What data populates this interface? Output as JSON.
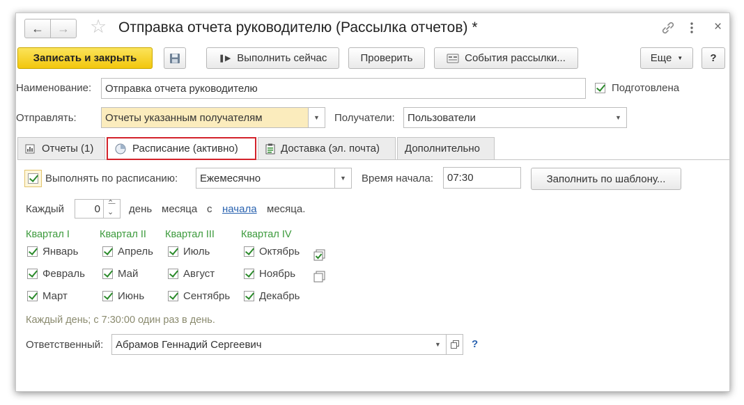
{
  "window": {
    "title": "Отправка отчета руководителю (Рассылка отчетов) *"
  },
  "toolbar": {
    "save_close": "Записать и закрыть",
    "run_now": "Выполнить сейчас",
    "check": "Проверить",
    "events": "События рассылки...",
    "more": "Еще",
    "help": "?"
  },
  "form": {
    "name_label": "Наименование:",
    "name_value": "Отправка отчета руководителю",
    "prepared_label": "Подготовлена",
    "send_label": "Отправлять:",
    "send_value": "Отчеты указанным получателям",
    "recipients_label": "Получатели:",
    "recipients_value": "Пользователи"
  },
  "tabs": [
    {
      "label": "Отчеты (1)"
    },
    {
      "label": "Расписание (активно)"
    },
    {
      "label": "Доставка (эл. почта)"
    },
    {
      "label": "Дополнительно"
    }
  ],
  "schedule": {
    "run_label": "Выполнять по расписанию:",
    "period_value": "Ежемесячно",
    "start_time_label": "Время начала:",
    "start_time_value": "07:30",
    "fill_template": "Заполнить по шаблону...",
    "every_label": "Каждый",
    "day_value": "0",
    "day_of_month_label": "день",
    "month_word": "месяца",
    "from_word": "с",
    "start_link": "начала",
    "month_suffix": "месяца."
  },
  "quarters": [
    {
      "label": "Квартал I",
      "months": [
        "Январь",
        "Февраль",
        "Март"
      ]
    },
    {
      "label": "Квартал II",
      "months": [
        "Апрель",
        "Май",
        "Июнь"
      ]
    },
    {
      "label": "Квартал III",
      "months": [
        "Июль",
        "Август",
        "Сентябрь"
      ]
    },
    {
      "label": "Квартал IV",
      "months": [
        "Октябрь",
        "Ноябрь",
        "Декабрь"
      ]
    }
  ],
  "summary": "Каждый день; с 7:30:00 один раз в день.",
  "responsible": {
    "label": "Ответственный:",
    "value": "Абрамов Геннадий Сергеевич",
    "help": "?"
  },
  "colors": {
    "accent_yellow": "#f2c70d",
    "tab_highlight": "#d3222a",
    "quarter_green": "#3c9a3c",
    "link_blue": "#2a63b0"
  }
}
